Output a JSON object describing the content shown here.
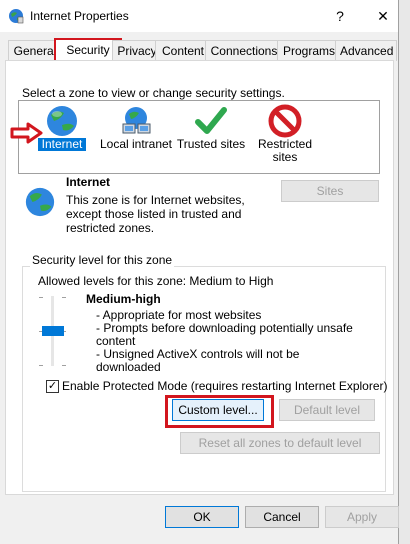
{
  "window": {
    "title": "Internet Properties",
    "help_glyph": "?",
    "close_glyph": "✕"
  },
  "tabs": [
    {
      "label": "General"
    },
    {
      "label": "Security"
    },
    {
      "label": "Privacy"
    },
    {
      "label": "Content"
    },
    {
      "label": "Connections"
    },
    {
      "label": "Programs"
    },
    {
      "label": "Advanced"
    }
  ],
  "security": {
    "zone_prompt": "Select a zone to view or change security settings.",
    "zones": [
      {
        "label": "Internet",
        "icon": "globe-icon"
      },
      {
        "label": "Local intranet",
        "icon": "network-icon"
      },
      {
        "label": "Trusted sites",
        "icon": "checkmark-icon"
      },
      {
        "label": "Restricted sites",
        "icon": "prohibited-icon"
      }
    ],
    "selected_zone": {
      "name": "Internet",
      "description": "This zone is for Internet websites, except those listed in trusted and restricted zones."
    },
    "sites_button": "Sites",
    "level_group_title": "Security level for this zone",
    "allowed_levels": "Allowed levels for this zone: Medium to High",
    "level_name": "Medium-high",
    "level_bullets": [
      "- Appropriate for most websites",
      "- Prompts before downloading potentially unsafe content",
      "- Unsigned ActiveX controls will not be downloaded"
    ],
    "protected_mode_label": "Enable Protected Mode (requires restarting Internet Explorer)",
    "protected_mode_checked": true,
    "checkmark_glyph": "✓",
    "custom_level_button": "Custom level...",
    "default_level_button": "Default level",
    "reset_all_button": "Reset all zones to default level"
  },
  "footer": {
    "ok": "OK",
    "cancel": "Cancel",
    "apply": "Apply"
  },
  "colors": {
    "highlight": "#d2161e",
    "accent": "#0078d7"
  }
}
